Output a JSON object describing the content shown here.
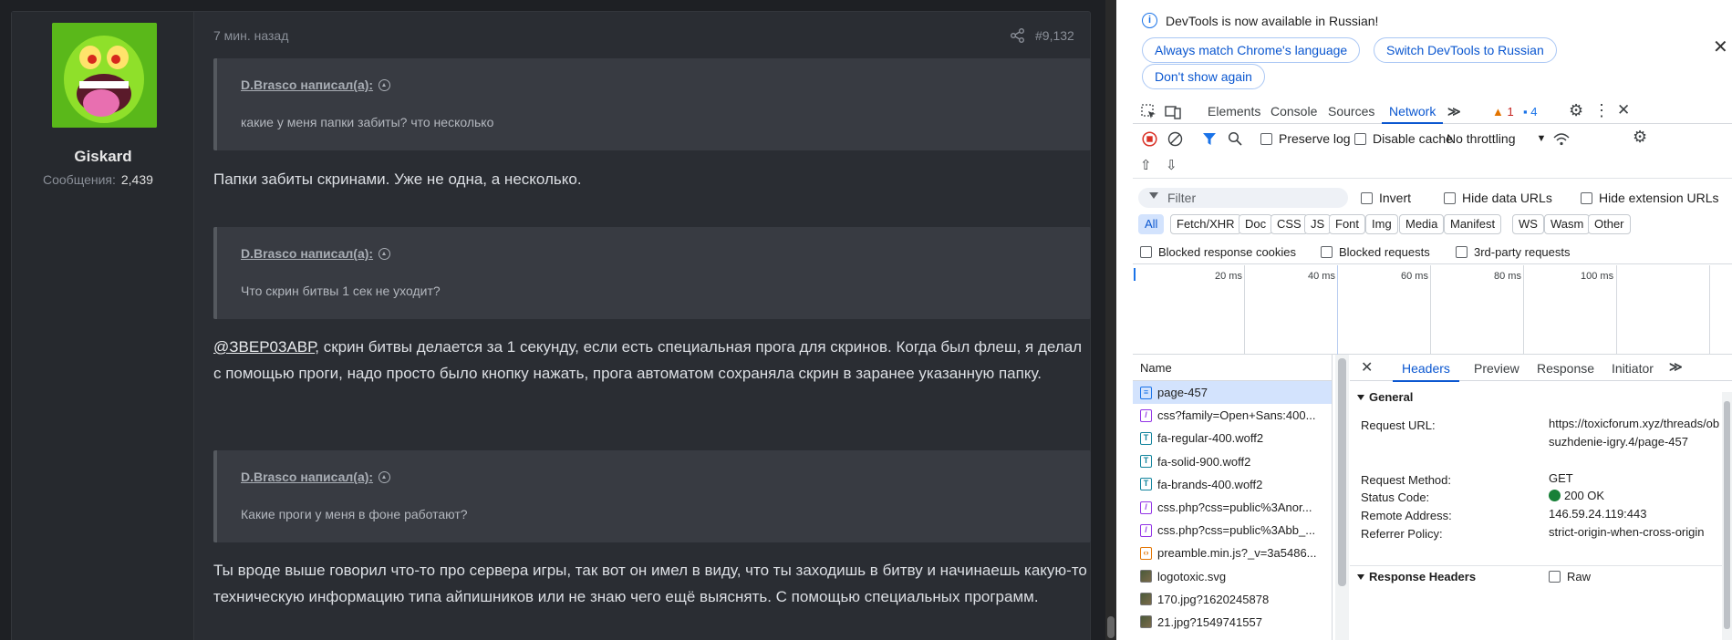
{
  "forum": {
    "username": "Giskard",
    "messages_label": "Сообщения:",
    "messages_count": "2,439",
    "time_ago": "7 мин. назад",
    "post_number": "#9,132",
    "quotes": [
      {
        "author": "D.Brasco написал(а):",
        "text": "какие у меня папки забиты? что несколько"
      },
      {
        "author": "D.Brasco написал(а):",
        "text": "Что скрин битвы 1 сек не уходит?"
      },
      {
        "author": "D.Brasco написал(а):",
        "text": "Какие проги у меня в фоне работают?"
      }
    ],
    "reply1": "Папки забиты скринами. Уже не одна, а несколько.",
    "reply2_mention": "@ЗВЕР03АВР",
    "reply2_rest": ", скрин битвы делается за 1 секунду, если есть специальная прога для скринов. Когда был флеш, я делал с помощью проги, надо просто было кнопку нажать, прога автоматом сохраняла скрин в заранее указанную папку.",
    "reply3": "Ты вроде выше говорил что-то про сервера игры, так вот он имел в виду, что ты заходишь в битву и начинаешь какую-то техническую информацию типа айпишников или не знаю чего ещё выяснять. С помощью специальных программ."
  },
  "devtools": {
    "info_text": "DevTools is now available in Russian!",
    "btn_match": "Always match Chrome's language",
    "btn_switch": "Switch DevTools to Russian",
    "btn_dont_show": "Don't show again",
    "tabs": [
      "Elements",
      "Console",
      "Sources",
      "Network"
    ],
    "warnings_count": "1",
    "messages_count": "4",
    "preserve_log": "Preserve log",
    "disable_cache": "Disable cache",
    "throttling": "No throttling",
    "filter_placeholder": "Filter",
    "invert": "Invert",
    "hide_data_urls": "Hide data URLs",
    "hide_extension_urls": "Hide extension URLs",
    "type_filters": [
      "All",
      "Fetch/XHR",
      "Doc",
      "CSS",
      "JS",
      "Font",
      "Img",
      "Media",
      "Manifest",
      "WS",
      "Wasm",
      "Other"
    ],
    "blocked_response_cookies": "Blocked response cookies",
    "blocked_requests": "Blocked requests",
    "third_party_requests": "3rd-party requests",
    "timeline_labels": [
      "20 ms",
      "40 ms",
      "60 ms",
      "80 ms",
      "100 ms"
    ],
    "name_header": "Name",
    "requests": [
      {
        "name": "page-457",
        "icon": "doc"
      },
      {
        "name": "css?family=Open+Sans:400...",
        "icon": "css"
      },
      {
        "name": "fa-regular-400.woff2",
        "icon": "font"
      },
      {
        "name": "fa-solid-900.woff2",
        "icon": "font"
      },
      {
        "name": "fa-brands-400.woff2",
        "icon": "font"
      },
      {
        "name": "css.php?css=public%3Anor...",
        "icon": "css"
      },
      {
        "name": "css.php?css=public%3Abb_...",
        "icon": "css"
      },
      {
        "name": "preamble.min.js?_v=3a5486...",
        "icon": "js"
      },
      {
        "name": "logotoxic.svg",
        "icon": "img"
      },
      {
        "name": "170.jpg?1620245878",
        "icon": "img"
      },
      {
        "name": "21.jpg?1549741557",
        "icon": "img"
      }
    ],
    "detail_tabs": [
      "Headers",
      "Preview",
      "Response",
      "Initiator"
    ],
    "general_label": "General",
    "request_url_label": "Request URL:",
    "request_url": "https://toxicforum.xyz/threads/obsuzhdenie-igry.4/page-457",
    "request_method_label": "Request Method:",
    "request_method": "GET",
    "status_code_label": "Status Code:",
    "status_code": "200 OK",
    "remote_address_label": "Remote Address:",
    "remote_address": "146.59.24.119:443",
    "referrer_policy_label": "Referrer Policy:",
    "referrer_policy": "strict-origin-when-cross-origin",
    "response_headers_label": "Response Headers",
    "raw_label": "Raw",
    "colors": {
      "accent": "#0b57d0",
      "status_ok": "#188038",
      "forum_bg": "#2a2d33"
    }
  }
}
